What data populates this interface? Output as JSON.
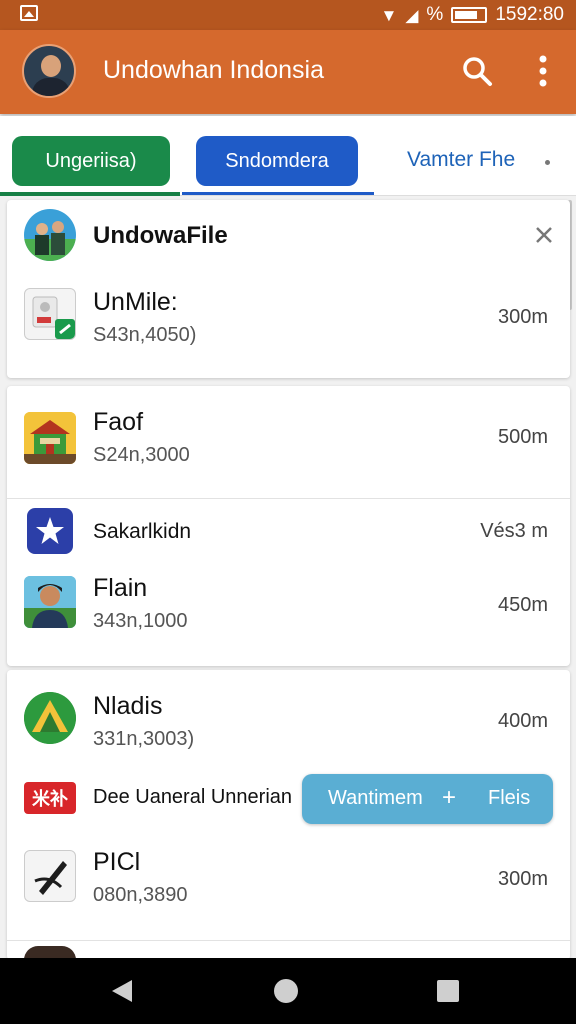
{
  "status_bar": {
    "time": "1592:80",
    "percent_glyph": "%"
  },
  "app_bar": {
    "title": "Undowhan Indonsia",
    "search_icon": "search-icon",
    "more_icon": "more-vert-icon"
  },
  "tabs": [
    {
      "label": "Ungeriisa)",
      "color": "#1a8a4a"
    },
    {
      "label": "Sndomdera",
      "color": "#1f5bc7"
    },
    {
      "label": "Vamter Fhe"
    }
  ],
  "cards": [
    {
      "header": {
        "title": "UndowaFile",
        "close_icon": "close-icon"
      },
      "items": [
        {
          "title": "UnMile:",
          "subtitle": "S43n,4050)",
          "size": "300m"
        }
      ]
    },
    {
      "items": [
        {
          "title": "Faof",
          "subtitle": "S24n,3000",
          "size": "500m"
        },
        {
          "title": "Sakarlkidn",
          "subtitle": "",
          "size": "Vés3 m"
        },
        {
          "title": "Flain",
          "subtitle": "343n,1000",
          "size": "450m"
        }
      ]
    },
    {
      "items": [
        {
          "title": "Nladis",
          "subtitle": "331n,3003)",
          "size": "400m"
        },
        {
          "title": "Dee Uaneral Unnerian",
          "subtitle": "",
          "size": ""
        },
        {
          "title": "PICl",
          "subtitle": "080n,3890",
          "size": "300m"
        }
      ]
    }
  ],
  "fab": {
    "label": "Wantimem",
    "plus": "+",
    "right_label": "Fleis"
  },
  "badge_text": "米补",
  "nav": {
    "back_icon": "back-icon",
    "home_icon": "home-icon",
    "recents_icon": "recents-icon"
  }
}
